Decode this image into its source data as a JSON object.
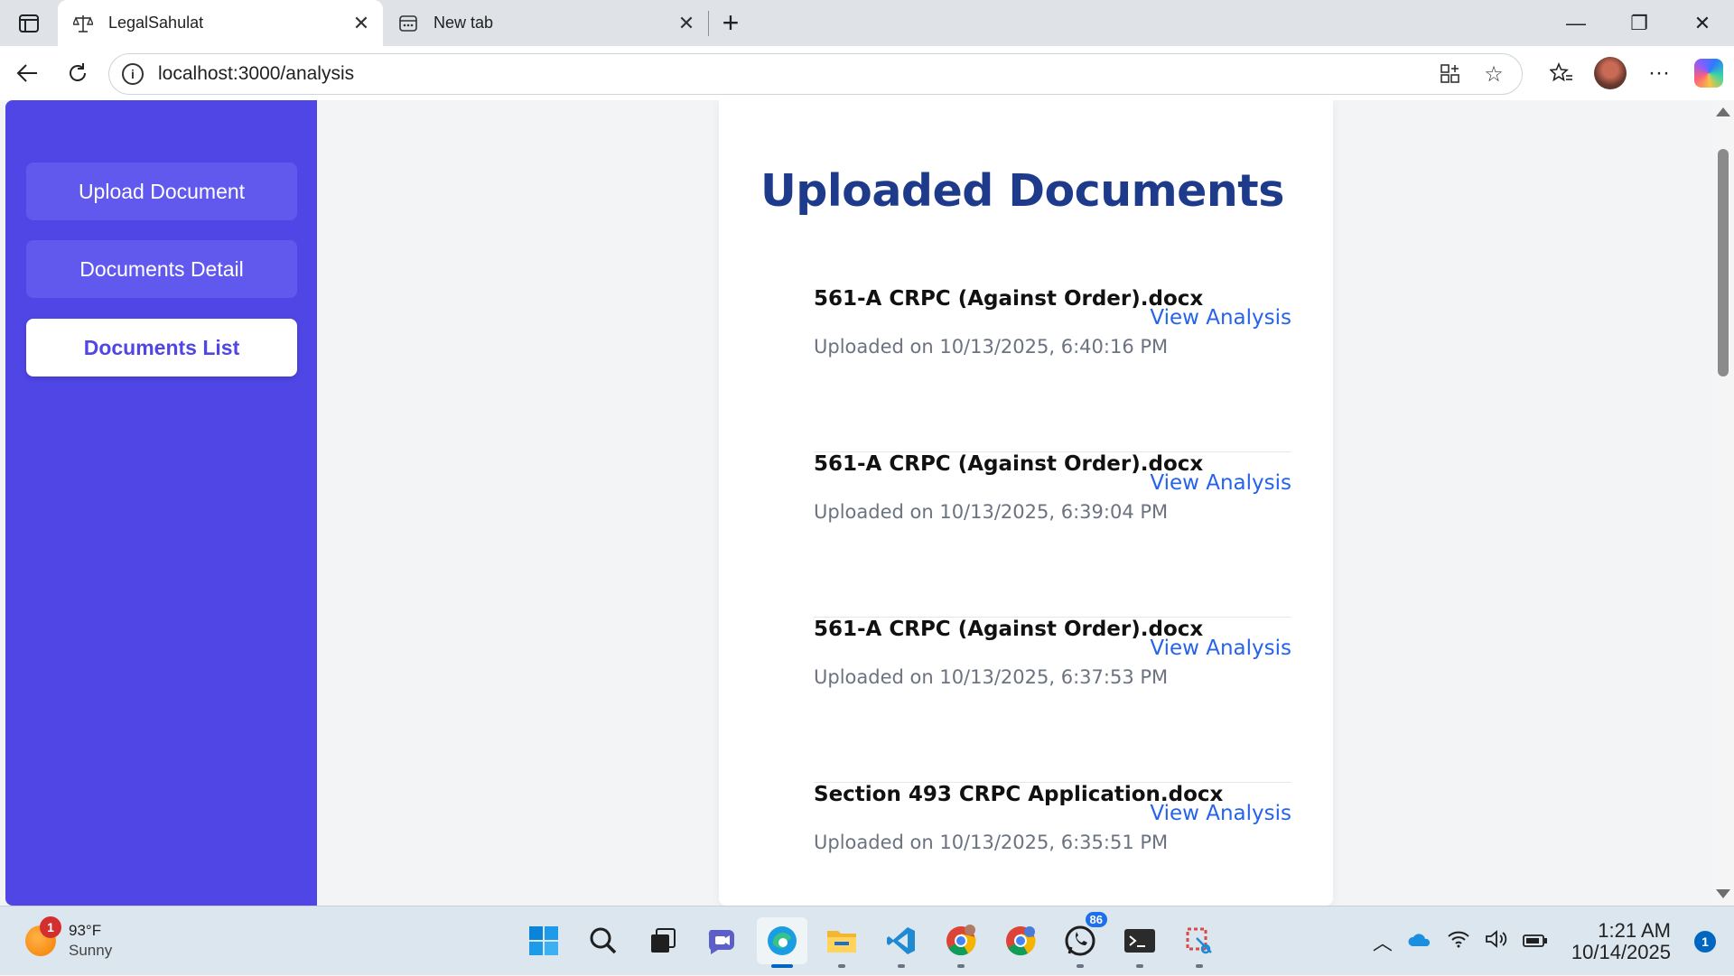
{
  "browser": {
    "tabs": [
      {
        "title": "LegalSahulat",
        "icon": "scales-icon",
        "active": true
      },
      {
        "title": "New tab",
        "icon": "newtab-icon",
        "active": false
      }
    ],
    "url": "localhost:3000/analysis"
  },
  "sidebar": {
    "items": [
      {
        "label": "Upload Document",
        "active": false
      },
      {
        "label": "Documents Detail",
        "active": false
      },
      {
        "label": "Documents List",
        "active": true
      }
    ]
  },
  "main": {
    "title": "Uploaded Documents",
    "link_label": "View Analysis",
    "documents": [
      {
        "name": "561-A CRPC (Against Order).docx",
        "uploaded": "Uploaded on 10/13/2025, 6:40:16 PM"
      },
      {
        "name": "561-A CRPC (Against Order).docx",
        "uploaded": "Uploaded on 10/13/2025, 6:39:04 PM"
      },
      {
        "name": "561-A CRPC (Against Order).docx",
        "uploaded": "Uploaded on 10/13/2025, 6:37:53 PM"
      },
      {
        "name": "Section 493 CRPC Application.docx",
        "uploaded": "Uploaded on 10/13/2025, 6:35:51 PM"
      }
    ]
  },
  "taskbar": {
    "weather": {
      "temp": "93°F",
      "condition": "Sunny",
      "badge": "1"
    },
    "whatsapp_badge": "86",
    "clock": {
      "time": "1:21 AM",
      "date": "10/14/2025"
    },
    "notifications": "1"
  },
  "colors": {
    "sidebar": "#4f46e5",
    "title": "#1e3a8a",
    "link": "#2563eb"
  }
}
